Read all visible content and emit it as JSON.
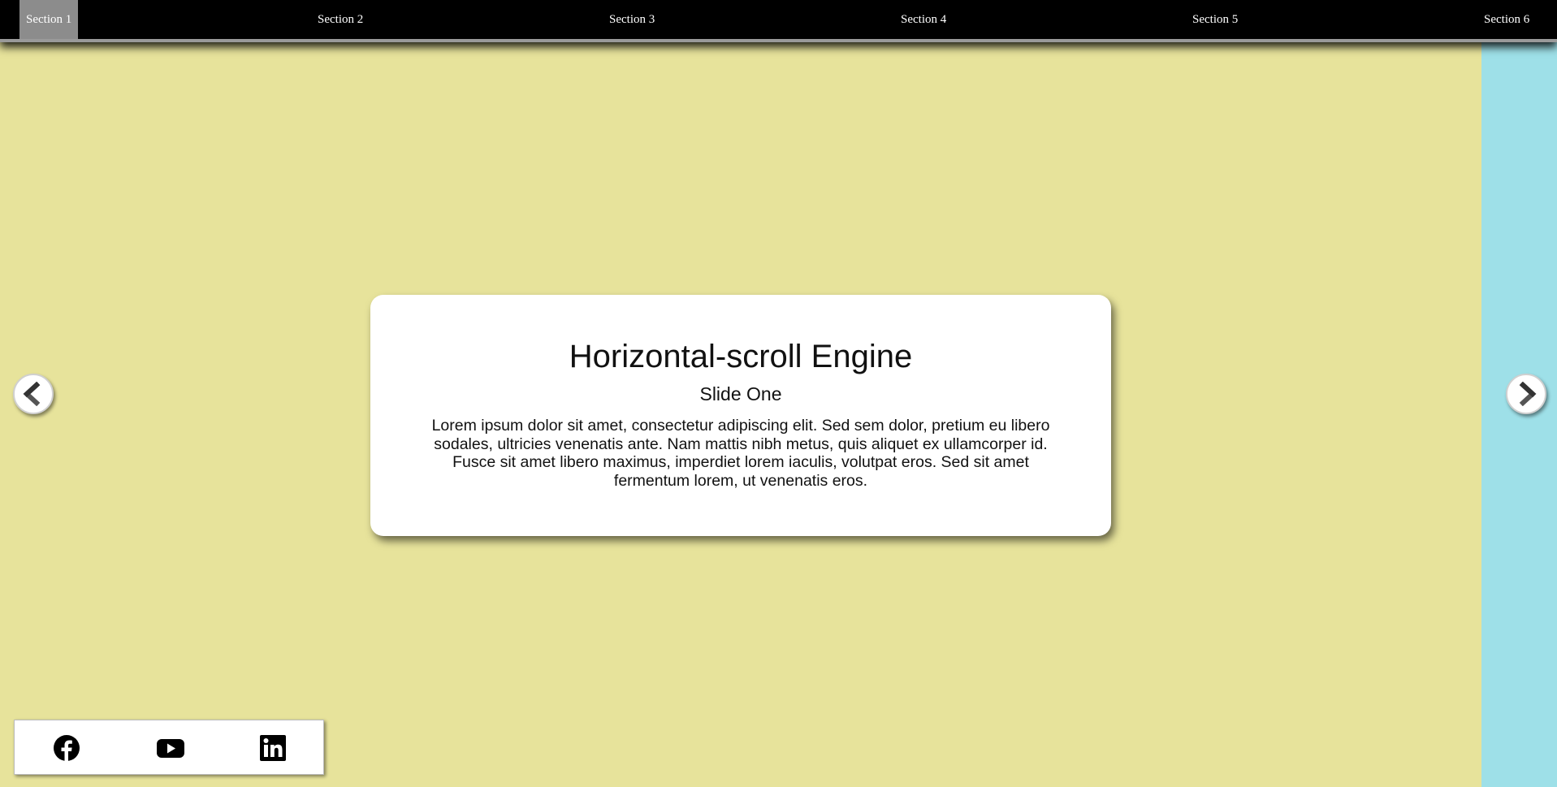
{
  "nav": {
    "sections": [
      {
        "label": "Section 1",
        "active": true
      },
      {
        "label": "Section 2",
        "active": false
      },
      {
        "label": "Section 3",
        "active": false
      },
      {
        "label": "Section 4",
        "active": false
      },
      {
        "label": "Section 5",
        "active": false
      },
      {
        "label": "Section 6",
        "active": false
      }
    ]
  },
  "slide": {
    "title": "Horizontal-scroll Engine",
    "subtitle": "Slide One",
    "body": "Lorem ipsum dolor sit amet, consectetur adipiscing elit. Sed sem dolor, pretium eu libero sodales, ultricies venenatis ante. Nam mattis nibh metus, quis aliquet ex ullamcorper id. Fusce sit amet libero maximus, imperdiet lorem iaculis, volutpat eros. Sed sit amet fermentum lorem, ut venenatis eros."
  },
  "arrows": {
    "prev_icon": "chevron-left-icon",
    "next_icon": "chevron-right-icon"
  },
  "social": {
    "icons": [
      "facebook-icon",
      "youtube-icon",
      "linkedin-icon"
    ]
  },
  "colors": {
    "slide_one_bg": "#e7e39b",
    "slide_two_bg": "#9ee0e8",
    "nav_bg": "#000000",
    "nav_active": "#8c8c8c"
  }
}
